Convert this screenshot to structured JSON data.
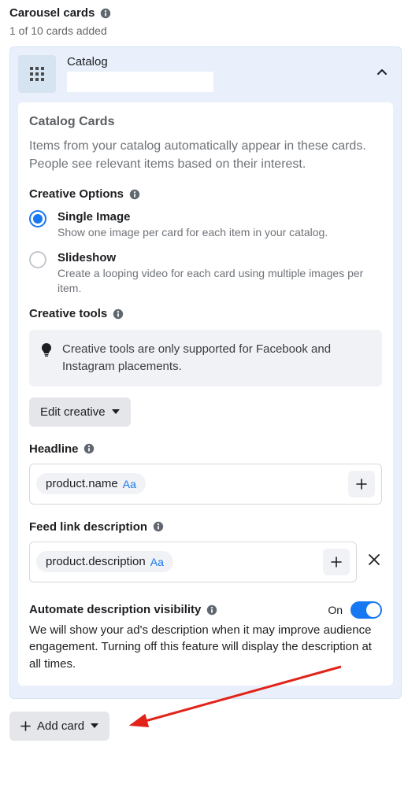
{
  "section": {
    "title": "Carousel cards",
    "subtext": "1 of 10 cards added"
  },
  "card": {
    "title": "Catalog"
  },
  "panel": {
    "title": "Catalog Cards",
    "desc": "Items from your catalog automatically appear in these cards. People see relevant items based on their interest."
  },
  "creative_options": {
    "heading": "Creative Options",
    "single": {
      "label": "Single Image",
      "desc": "Show one image per card for each item in your catalog."
    },
    "slideshow": {
      "label": "Slideshow",
      "desc": "Create a looping video for each card using multiple images per item."
    }
  },
  "creative_tools": {
    "heading": "Creative tools",
    "notice": "Creative tools are only supported for Facebook and Instagram placements.",
    "edit_label": "Edit creative"
  },
  "headline": {
    "label": "Headline",
    "chip": "product.name",
    "aa": "Aa"
  },
  "feed_desc": {
    "label": "Feed link description",
    "chip": "product.description",
    "aa": "Aa"
  },
  "automate": {
    "label": "Automate description visibility",
    "state": "On",
    "desc": "We will show your ad's description when it may improve audience engagement. Turning off this feature will display the description at all times."
  },
  "add_card": {
    "label": "Add card"
  }
}
